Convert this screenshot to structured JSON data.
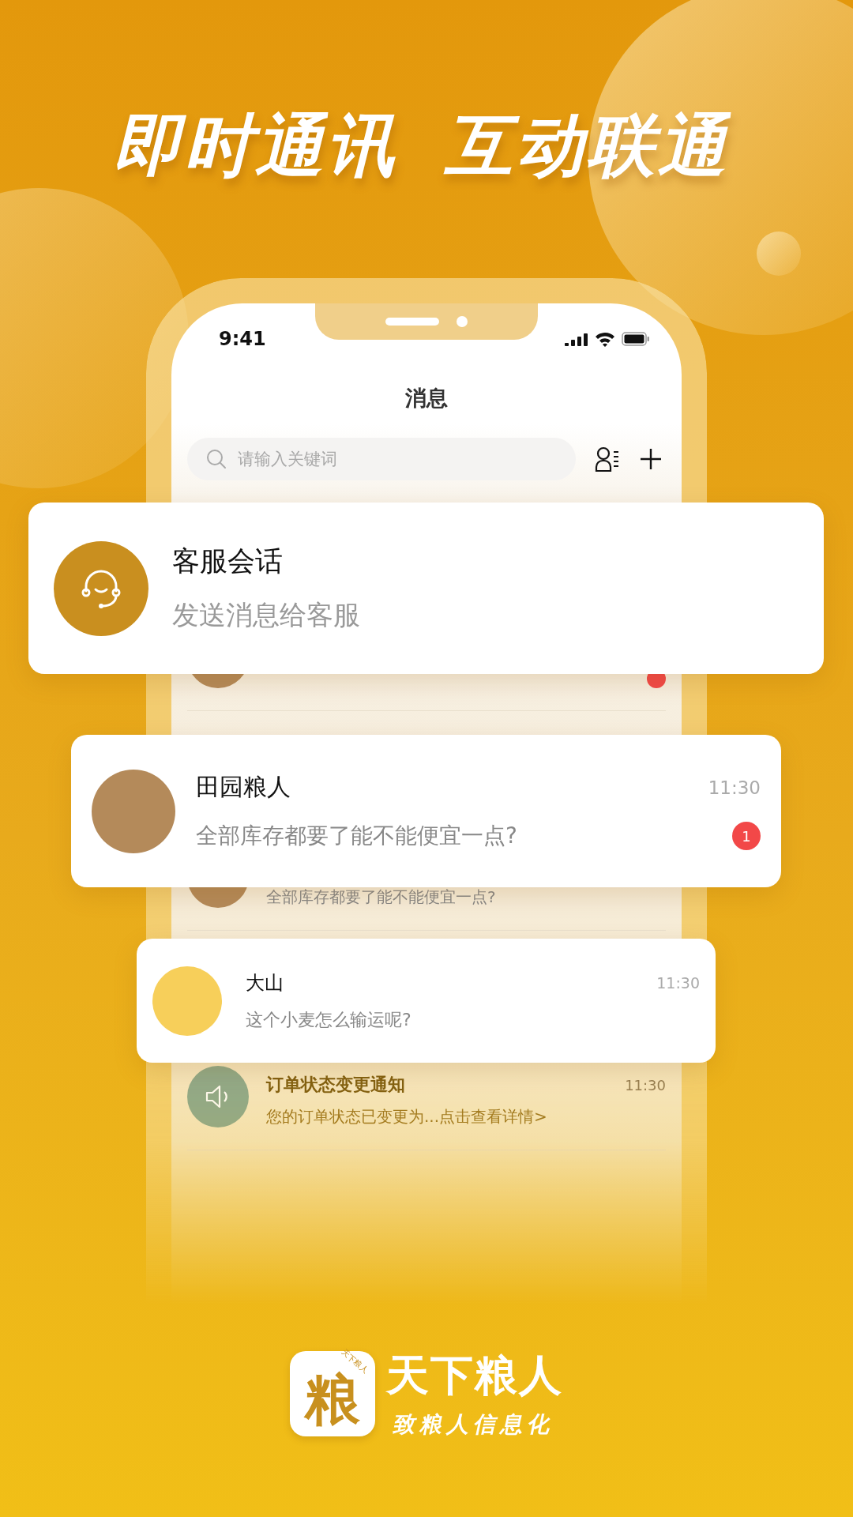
{
  "headline": [
    "即时通讯",
    "互动联通"
  ],
  "phone": {
    "status_time": "9:41",
    "title": "消息",
    "search": {
      "placeholder": "请输入关键词"
    },
    "rows": [
      {
        "kind": "covered",
        "unread": true
      },
      {
        "kind": "chat",
        "message": "全部库存都要了能不能便宜一点?"
      },
      {
        "kind": "notice",
        "title": "订单状态变更通知",
        "time": "11:30",
        "message": "您的订单状态已变更为...点击查看详情>"
      }
    ]
  },
  "service_card": {
    "title": "客服会话",
    "subtitle": "发送消息给客服"
  },
  "chat_cards": [
    {
      "kind": "large",
      "name": "田园粮人",
      "time": "11:30",
      "message": "全部库存都要了能不能便宜一点?",
      "unread": "1"
    },
    {
      "kind": "small",
      "name": "大山",
      "time": "11:30",
      "message": "这个小麦怎么输运呢?"
    }
  ],
  "brand": {
    "icon_char": "粮",
    "icon_tag": "天下粮人",
    "name": "天下粮人",
    "slogan": "致粮人信息化"
  }
}
